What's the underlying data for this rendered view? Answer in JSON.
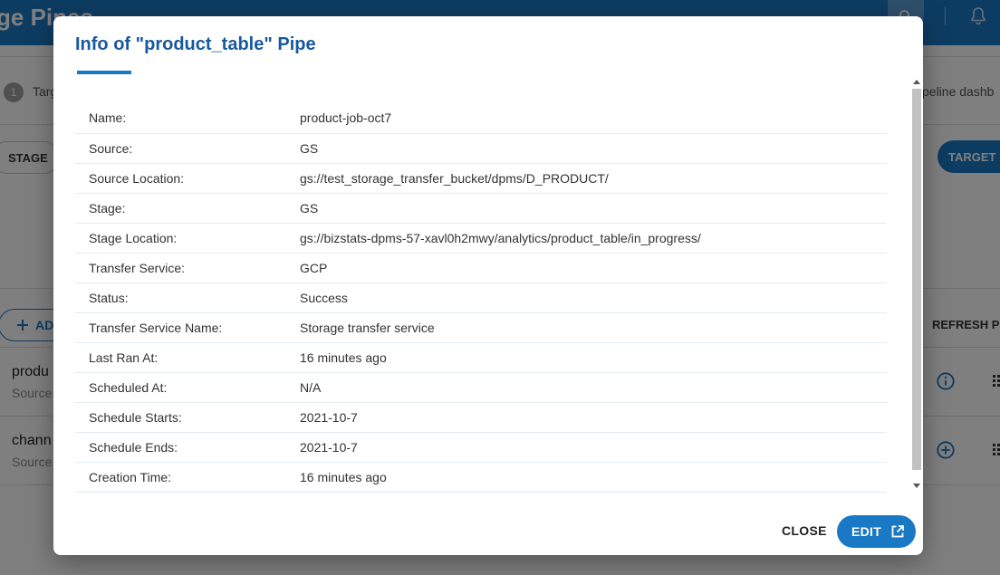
{
  "app": {
    "title": "ge Pipes",
    "step_number": "1",
    "step_label": "Targ",
    "step_label_right": "peline dashb",
    "stage_chip": "STAGE",
    "target_button": "TARGET P",
    "add_button": "AD",
    "refresh_button": "REFRESH PI",
    "rows": [
      {
        "title": "produ",
        "subtitle": "Source",
        "icon": "info-icon"
      },
      {
        "title": "chann",
        "subtitle": "Source",
        "icon": "add-circle-icon"
      }
    ]
  },
  "dialog": {
    "title": "Info of \"product_table\" Pipe",
    "fields": [
      {
        "label": "Name:",
        "value": "product-job-oct7"
      },
      {
        "label": "Source:",
        "value": "GS"
      },
      {
        "label": "Source Location:",
        "value": "gs://test_storage_transfer_bucket/dpms/D_PRODUCT/"
      },
      {
        "label": "Stage:",
        "value": "GS"
      },
      {
        "label": "Stage Location:",
        "value": "gs://bizstats-dpms-57-xavl0h2mwy/analytics/product_table/in_progress/"
      },
      {
        "label": "Transfer Service:",
        "value": "GCP"
      },
      {
        "label": "Status:",
        "value": "Success"
      },
      {
        "label": "Transfer Service Name:",
        "value": "Storage transfer service"
      },
      {
        "label": "Last Ran At:",
        "value": "16 minutes ago"
      },
      {
        "label": "Scheduled At:",
        "value": "N/A"
      },
      {
        "label": "Schedule Starts:",
        "value": "2021-10-7"
      },
      {
        "label": "Schedule Ends:",
        "value": "2021-10-7"
      },
      {
        "label": "Creation Time:",
        "value": "16 minutes ago"
      }
    ],
    "close_label": "CLOSE",
    "edit_label": "EDIT",
    "edit_icon": "open-in-new-icon"
  },
  "colors": {
    "primary": "#1a79c4",
    "title": "#17589e",
    "row_divider": "#e3ecf4"
  }
}
